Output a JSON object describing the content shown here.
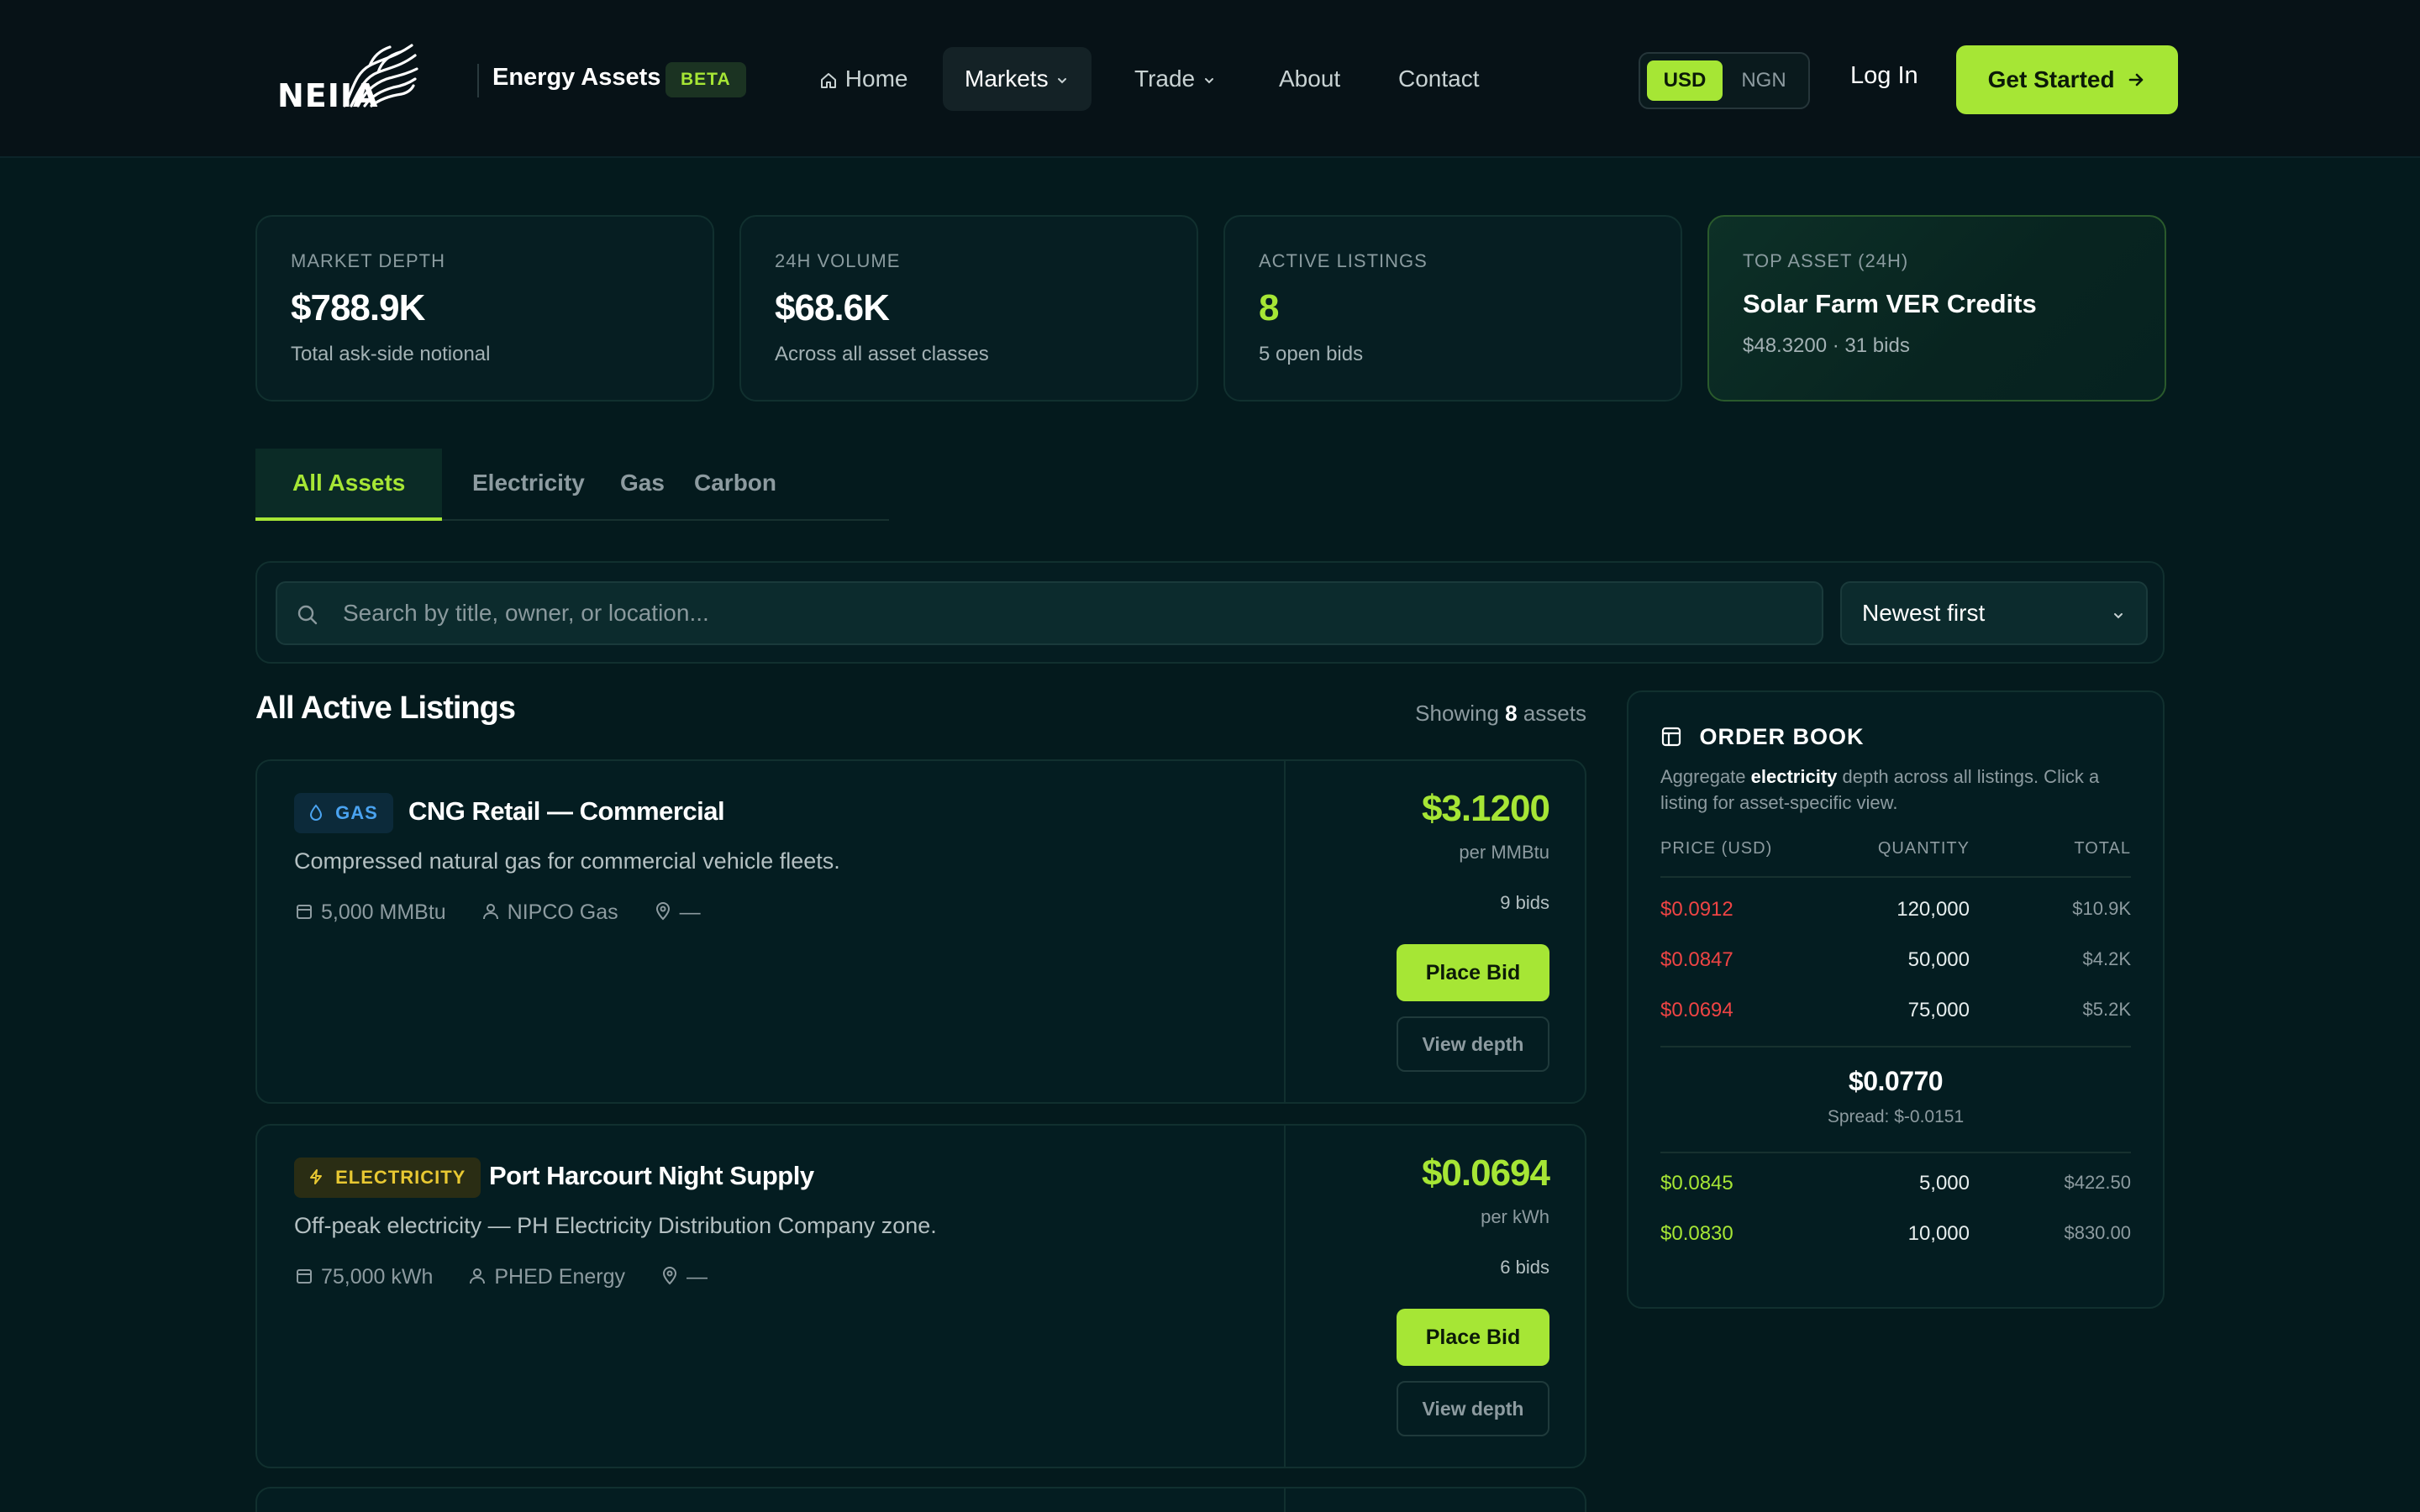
{
  "header": {
    "logo_text": "NEIIA",
    "brand_name": "Energy Assets",
    "beta": "BETA",
    "nav": {
      "home": "Home",
      "markets": "Markets",
      "trade": "Trade",
      "about": "About",
      "contact": "Contact"
    },
    "currency": {
      "usd": "USD",
      "ngn": "NGN",
      "selected": "USD"
    },
    "login": "Log In",
    "get_started": "Get Started"
  },
  "stats": {
    "depth": {
      "label": "MARKET DEPTH",
      "value": "$788.9K",
      "sub": "Total ask-side notional"
    },
    "volume": {
      "label": "24H VOLUME",
      "value": "$68.6K",
      "sub": "Across all asset classes"
    },
    "active": {
      "label": "ACTIVE LISTINGS",
      "value": "8",
      "sub": "5 open bids"
    },
    "top": {
      "label": "TOP ASSET (24H)",
      "value": "Solar Farm VER Credits",
      "sub": "$48.3200 · 31 bids"
    }
  },
  "tabs": {
    "all": "All Assets",
    "electricity": "Electricity",
    "gas": "Gas",
    "carbon": "Carbon"
  },
  "search": {
    "placeholder": "Search by title, owner, or location...",
    "sort": "Newest first"
  },
  "listings_section": {
    "title": "All Active Listings",
    "showing_prefix": "Showing",
    "showing_count": "8",
    "showing_suffix": "assets"
  },
  "listings": [
    {
      "badge": "GAS",
      "title": "CNG Retail — Commercial",
      "description": "Compressed natural gas for commercial vehicle fleets.",
      "quantity": "5,000 MMBtu",
      "owner": "NIPCO Gas",
      "location": "—",
      "price": "$3.1200",
      "unit": "per MMBtu",
      "bids": "9 bids",
      "place_bid": "Place Bid",
      "view_depth": "View depth"
    },
    {
      "badge": "ELECTRICITY",
      "title": "Port Harcourt Night Supply",
      "description": "Off-peak electricity — PH Electricity Distribution Company zone.",
      "quantity": "75,000 kWh",
      "owner": "PHED Energy",
      "location": "—",
      "price": "$0.0694",
      "unit": "per kWh",
      "bids": "6 bids",
      "place_bid": "Place Bid",
      "view_depth": "View depth"
    }
  ],
  "orderbook": {
    "title": "ORDER BOOK",
    "desc_prefix": "Aggregate",
    "desc_bold": "electricity",
    "desc_suffix": "depth across all listings. Click a listing for asset-specific view.",
    "columns": {
      "price": "PRICE (USD)",
      "quantity": "QUANTITY",
      "total": "TOTAL"
    },
    "asks": [
      {
        "price": "$0.0912",
        "quantity": "120,000",
        "total": "$10.9K"
      },
      {
        "price": "$0.0847",
        "quantity": "50,000",
        "total": "$4.2K"
      },
      {
        "price": "$0.0694",
        "quantity": "75,000",
        "total": "$5.2K"
      }
    ],
    "mid": "$0.0770",
    "spread": "Spread: $-0.0151",
    "bids": [
      {
        "price": "$0.0845",
        "quantity": "5,000",
        "total": "$422.50"
      },
      {
        "price": "$0.0830",
        "quantity": "10,000",
        "total": "$830.00"
      }
    ]
  },
  "colors": {
    "accent": "#a6e635",
    "ask": "#ef4444",
    "background": "#041a1d",
    "gas_badge": "#4aa3f0",
    "electricity_badge": "#e8c832"
  }
}
